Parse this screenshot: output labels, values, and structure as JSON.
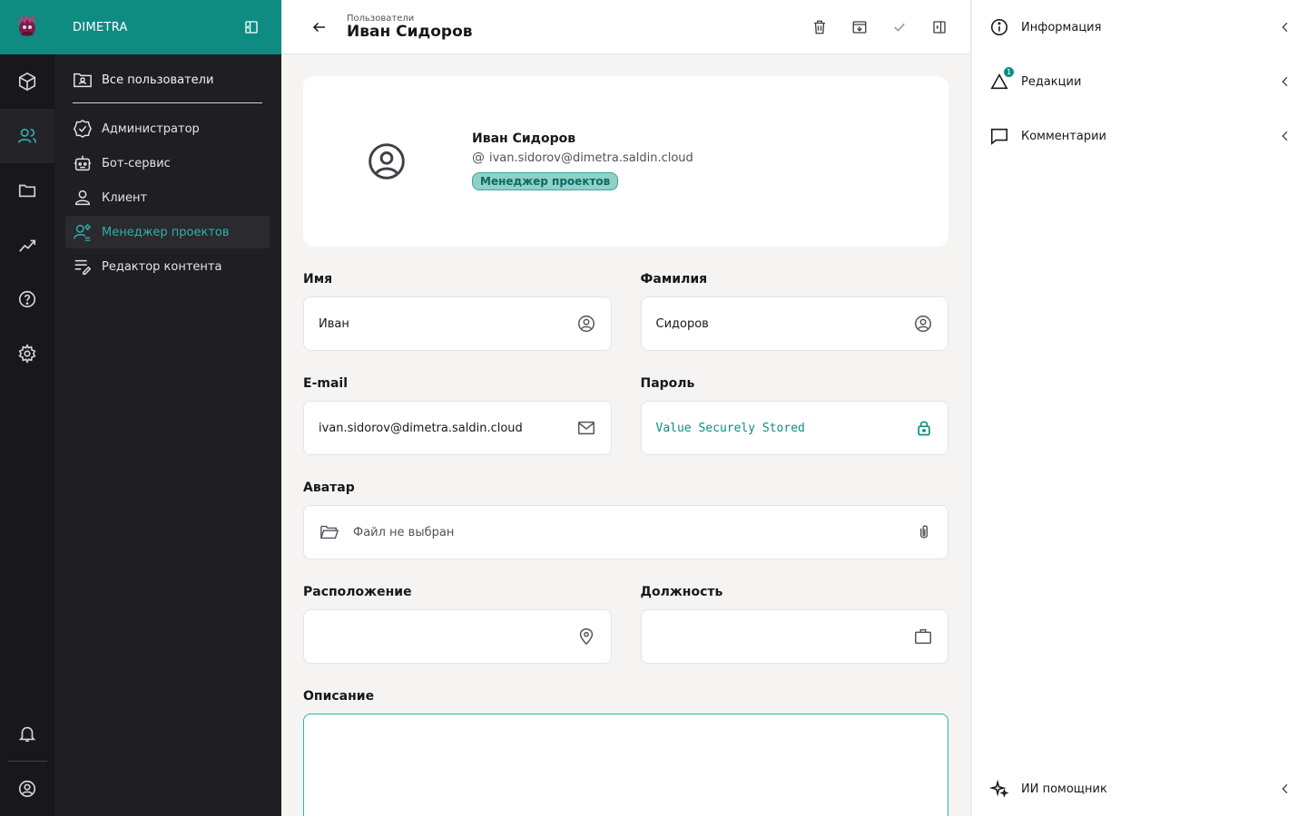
{
  "app": {
    "name": "DIMETRA"
  },
  "nav": {
    "all_users": "Все пользователи",
    "items": [
      {
        "label": "Администратор",
        "icon": "badge-check-icon"
      },
      {
        "label": "Бот-сервис",
        "icon": "bot-icon"
      },
      {
        "label": "Клиент",
        "icon": "user-icon"
      },
      {
        "label": "Менеджер проектов",
        "icon": "user-cog-icon",
        "active": true
      },
      {
        "label": "Редактор контента",
        "icon": "list-edit-icon"
      }
    ]
  },
  "header": {
    "breadcrumb": "Пользователи",
    "title": "Иван Сидоров"
  },
  "profile": {
    "name": "Иван Сидоров",
    "email": "ivan.sidorov@dimetra.saldin.cloud",
    "role": "Менеджер проектов"
  },
  "form": {
    "first_name": {
      "label": "Имя",
      "value": "Иван"
    },
    "last_name": {
      "label": "Фамилия",
      "value": "Сидоров"
    },
    "email": {
      "label": "E-mail",
      "value": "ivan.sidorov@dimetra.saldin.cloud"
    },
    "password": {
      "label": "Пароль",
      "value": "Value Securely Stored"
    },
    "avatar": {
      "label": "Аватар",
      "placeholder": "Файл не выбран"
    },
    "location": {
      "label": "Расположение",
      "value": ""
    },
    "position": {
      "label": "Должность",
      "value": ""
    },
    "description": {
      "label": "Описание",
      "value": ""
    }
  },
  "right_panel": {
    "items": [
      {
        "label": "Информация",
        "icon": "info-icon"
      },
      {
        "label": "Редакции",
        "icon": "revisions-icon",
        "badge": "1"
      },
      {
        "label": "Комментарии",
        "icon": "comment-icon"
      }
    ],
    "ai": {
      "label": "ИИ помощник",
      "icon": "sparkles-icon"
    }
  },
  "colors": {
    "accent": "#0e8c82",
    "accent_light": "#2bb3a5",
    "rail": "#18181b",
    "sidebar": "#1f1f23"
  }
}
